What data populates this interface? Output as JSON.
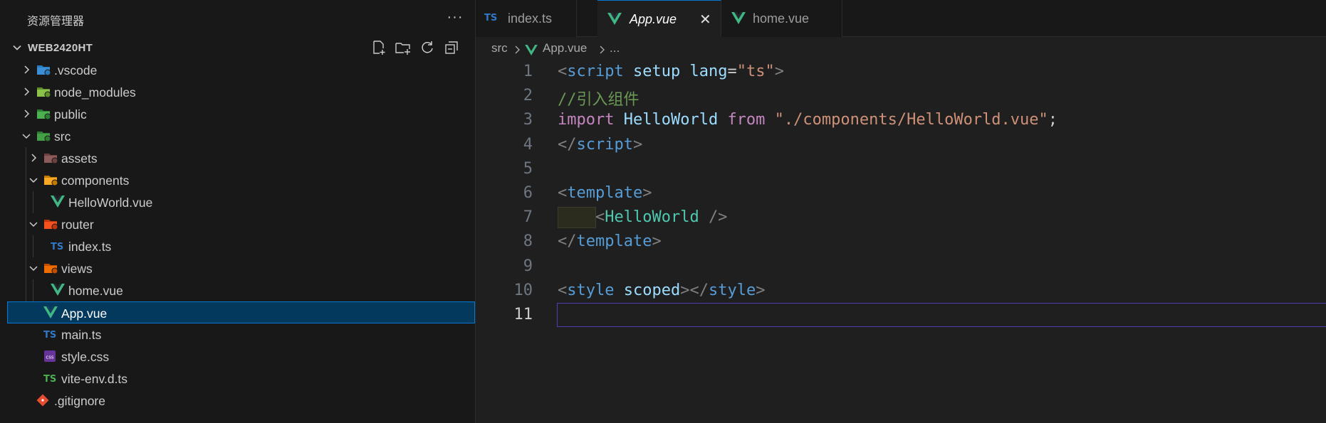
{
  "explorer": {
    "title": "资源管理器",
    "more": "···",
    "workspace": "WEB2420HT",
    "actions": [
      "new-file-icon",
      "new-folder-icon",
      "refresh-icon",
      "collapse-all-icon"
    ]
  },
  "tree": [
    {
      "label": ".vscode",
      "icon": "vscode-folder-icon",
      "depth": 0,
      "type": "folder",
      "expanded": false
    },
    {
      "label": "node_modules",
      "icon": "node-folder-icon",
      "depth": 0,
      "type": "folder",
      "expanded": false
    },
    {
      "label": "public",
      "icon": "public-folder-icon",
      "depth": 0,
      "type": "folder",
      "expanded": false
    },
    {
      "label": "src",
      "icon": "src-folder-icon",
      "depth": 0,
      "type": "folder",
      "expanded": true
    },
    {
      "label": "assets",
      "icon": "assets-folder-icon",
      "depth": 1,
      "type": "folder",
      "expanded": false
    },
    {
      "label": "components",
      "icon": "components-folder-icon",
      "depth": 1,
      "type": "folder",
      "expanded": true
    },
    {
      "label": "HelloWorld.vue",
      "icon": "vue-icon",
      "depth": 2,
      "type": "file"
    },
    {
      "label": "router",
      "icon": "router-folder-icon",
      "depth": 1,
      "type": "folder",
      "expanded": true
    },
    {
      "label": "index.ts",
      "icon": "ts-icon",
      "depth": 2,
      "type": "file"
    },
    {
      "label": "views",
      "icon": "views-folder-icon",
      "depth": 1,
      "type": "folder",
      "expanded": true
    },
    {
      "label": "home.vue",
      "icon": "vue-icon",
      "depth": 2,
      "type": "file"
    },
    {
      "label": "App.vue",
      "icon": "vue-icon",
      "depth": 1,
      "type": "file",
      "selected": true
    },
    {
      "label": "main.ts",
      "icon": "ts-icon",
      "depth": 1,
      "type": "file"
    },
    {
      "label": "style.css",
      "icon": "css-icon",
      "depth": 1,
      "type": "file"
    },
    {
      "label": "vite-env.d.ts",
      "icon": "ts-green-icon",
      "depth": 1,
      "type": "file"
    },
    {
      "label": ".gitignore",
      "icon": "git-icon",
      "depth": 0,
      "type": "file"
    }
  ],
  "tabs": [
    {
      "label": "index.ts",
      "icon": "ts-icon",
      "badge": "TS",
      "active": false
    },
    {
      "label": "App.vue",
      "icon": "vue-icon",
      "active": true,
      "close": "✕"
    },
    {
      "label": "home.vue",
      "icon": "vue-icon",
      "active": false
    }
  ],
  "breadcrumb": {
    "folder": "src",
    "file": "App.vue",
    "symbol": "..."
  },
  "editor": {
    "current_line": 11,
    "lines": [
      {
        "n": "1",
        "tokens": [
          [
            "c-punc",
            "<"
          ],
          [
            "c-tag",
            "script"
          ],
          [
            "c-plain",
            " "
          ],
          [
            "c-attr",
            "setup"
          ],
          [
            "c-plain",
            " "
          ],
          [
            "c-attr",
            "lang"
          ],
          [
            "c-plain",
            "="
          ],
          [
            "c-str",
            "\"ts\""
          ],
          [
            "c-punc",
            ">"
          ]
        ]
      },
      {
        "n": "2",
        "tokens": [
          [
            "c-cmt",
            "//引入组件"
          ]
        ]
      },
      {
        "n": "3",
        "tokens": [
          [
            "c-kw",
            "import"
          ],
          [
            "c-plain",
            " "
          ],
          [
            "c-id",
            "HelloWorld"
          ],
          [
            "c-plain",
            " "
          ],
          [
            "c-kw",
            "from"
          ],
          [
            "c-plain",
            " "
          ],
          [
            "c-str",
            "\"./components/HelloWorld.vue\""
          ],
          [
            "c-plain",
            ";"
          ]
        ]
      },
      {
        "n": "4",
        "tokens": [
          [
            "c-punc",
            "</"
          ],
          [
            "c-tag",
            "script"
          ],
          [
            "c-punc",
            ">"
          ]
        ]
      },
      {
        "n": "5",
        "tokens": []
      },
      {
        "n": "6",
        "tokens": [
          [
            "c-punc",
            "<"
          ],
          [
            "c-tag",
            "template"
          ],
          [
            "c-punc",
            ">"
          ]
        ]
      },
      {
        "n": "7",
        "tokens": [
          [
            "c-plain",
            "    "
          ],
          [
            "c-punc",
            "<"
          ],
          [
            "c-comp",
            "HelloWorld"
          ],
          [
            "c-plain",
            " "
          ],
          [
            "c-punc",
            "/>"
          ]
        ],
        "indent_highlight": true
      },
      {
        "n": "8",
        "tokens": [
          [
            "c-punc",
            "</"
          ],
          [
            "c-tag",
            "template"
          ],
          [
            "c-punc",
            ">"
          ]
        ]
      },
      {
        "n": "9",
        "tokens": []
      },
      {
        "n": "10",
        "tokens": [
          [
            "c-punc",
            "<"
          ],
          [
            "c-tag",
            "style"
          ],
          [
            "c-plain",
            " "
          ],
          [
            "c-attr",
            "scoped"
          ],
          [
            "c-punc",
            "></"
          ],
          [
            "c-tag",
            "style"
          ],
          [
            "c-punc",
            ">"
          ]
        ]
      },
      {
        "n": "11",
        "tokens": []
      }
    ]
  },
  "colors": {
    "accent": "#0078d4",
    "vue": "#41b883",
    "ts": "#3178c6",
    "selection": "#04395e"
  }
}
